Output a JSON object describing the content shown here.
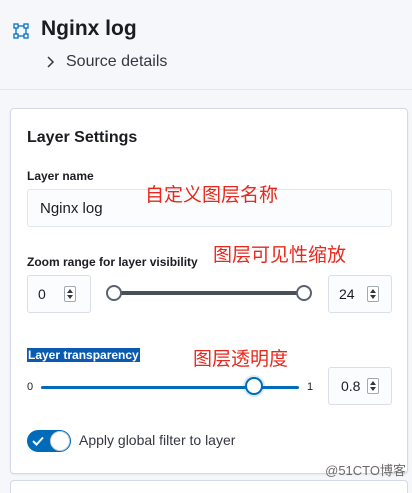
{
  "header": {
    "layer_icon": "layer-bounding-box-icon",
    "title": "Nginx log",
    "source_details_label": "Source details",
    "chevron_icon": "chevron-right-icon"
  },
  "panel": {
    "title": "Layer Settings",
    "layer_name": {
      "label": "Layer name",
      "value": "Nginx log"
    },
    "zoom_range": {
      "label": "Zoom range for layer visibility",
      "min_value": "0",
      "max_value": "24",
      "range_min": 0,
      "range_max": 24
    },
    "transparency": {
      "label": "Layer transparency",
      "min_tick": "0",
      "max_tick": "1",
      "value": "0.85",
      "value_display": "0.8"
    },
    "global_filter": {
      "label": "Apply global filter to layer",
      "enabled": true
    }
  },
  "annotations": {
    "layer_name_note": "自定义图层名称",
    "zoom_note": "图层可见性缩放",
    "transparency_note": "图层透明度"
  },
  "watermark": "@51CTO博客",
  "colors": {
    "accent": "#006bb8",
    "annotation": "#e8281c",
    "highlight": "#0a5bb0"
  }
}
